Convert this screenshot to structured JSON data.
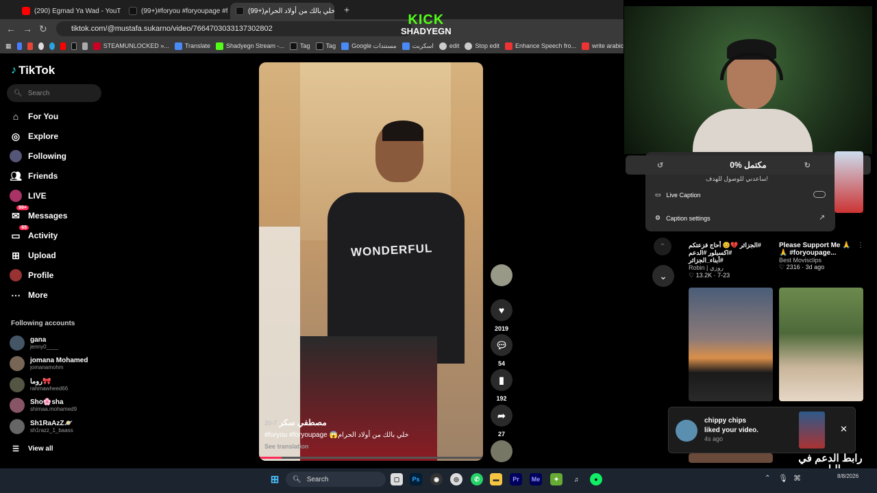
{
  "browser": {
    "tabs": [
      {
        "title": "(290) Egmad Ya Wad - YouTube",
        "icon_color": "#ff0000"
      },
      {
        "title": "(99+)#foryou #foryoupage #fy",
        "icon_color": "#222222"
      },
      {
        "title": "(99+)خلي بالك من أولاد الحرام",
        "icon_color": "#222222"
      }
    ],
    "url": "tiktok.com/@mustafa.sukarno/video/7664703033137302802",
    "bookmarks": [
      "STEAMUNLOCKED »...",
      "Translate",
      "Shadyegn Stream -...",
      "Tag",
      "Tag",
      "Google مستندات",
      "اسكربت",
      "edit",
      "Stop edit",
      "Enhance Speech fro...",
      "write arabic"
    ]
  },
  "tiktok": {
    "logo": "TikTok",
    "search_placeholder": "Search",
    "nav": [
      {
        "label": "For You",
        "icon": "home-icon"
      },
      {
        "label": "Explore",
        "icon": "compass-icon"
      },
      {
        "label": "Following",
        "icon": "following-icon"
      },
      {
        "label": "Friends",
        "icon": "friends-icon"
      },
      {
        "label": "LIVE",
        "icon": "live-icon"
      },
      {
        "label": "Messages",
        "icon": "messages-icon",
        "badge": "99+"
      },
      {
        "label": "Activity",
        "icon": "activity-icon",
        "badge": "65"
      },
      {
        "label": "Upload",
        "icon": "upload-icon"
      },
      {
        "label": "Profile",
        "icon": "profile-icon"
      },
      {
        "label": "More",
        "icon": "more-icon"
      }
    ],
    "following_title": "Following accounts",
    "accounts": [
      {
        "name": "gana",
        "handle": "jenny0____"
      },
      {
        "name": "jomana Mohamed",
        "handle": "jomanamohm"
      },
      {
        "name": "روما🎀",
        "handle": "rahmawheed66"
      },
      {
        "name": "Sho🌸sha",
        "handle": "shimaa.mohamed9"
      },
      {
        "name": "Sh1RaAzZ🪐",
        "handle": "sh1razz_1_baass"
      }
    ],
    "view_all": "View all",
    "video": {
      "author": "مصطفي سكر",
      "time": "7-20",
      "caption": "#foryou #foryoupage 😱خلي بالك من أولاد الحرام",
      "see_translation": "See translation",
      "likes": "2019",
      "comments": "54",
      "saves": "192",
      "shares": "27"
    }
  },
  "overlay": {
    "kick": "KICK",
    "channel": "SHADYEGN",
    "progress_text": "0% مكتمل",
    "progress_sub": "ساعدني للوصول للهدف!",
    "live_caption": "Live Caption",
    "caption_settings": "Caption settings",
    "promo": "رابط الدعم في البايو"
  },
  "grid": [
    {
      "caption": "#الجزائر 💔😊 أحاج فزعتكم #اكسبلور #الدعم #أبناء_الجزائر",
      "author": "Robin | روزي",
      "likes": "13.2K",
      "date": "7-23"
    },
    {
      "caption": "Please Support Me 🙏 🙏 #foryoupage...",
      "author": "Best Movisclips",
      "likes": "2316",
      "date": "3d ago"
    }
  ],
  "notification": {
    "name": "chippy chips",
    "message": "liked your video.",
    "time": "4s ago"
  },
  "taskbar": {
    "search": "Search",
    "date": "8/8/2026"
  }
}
